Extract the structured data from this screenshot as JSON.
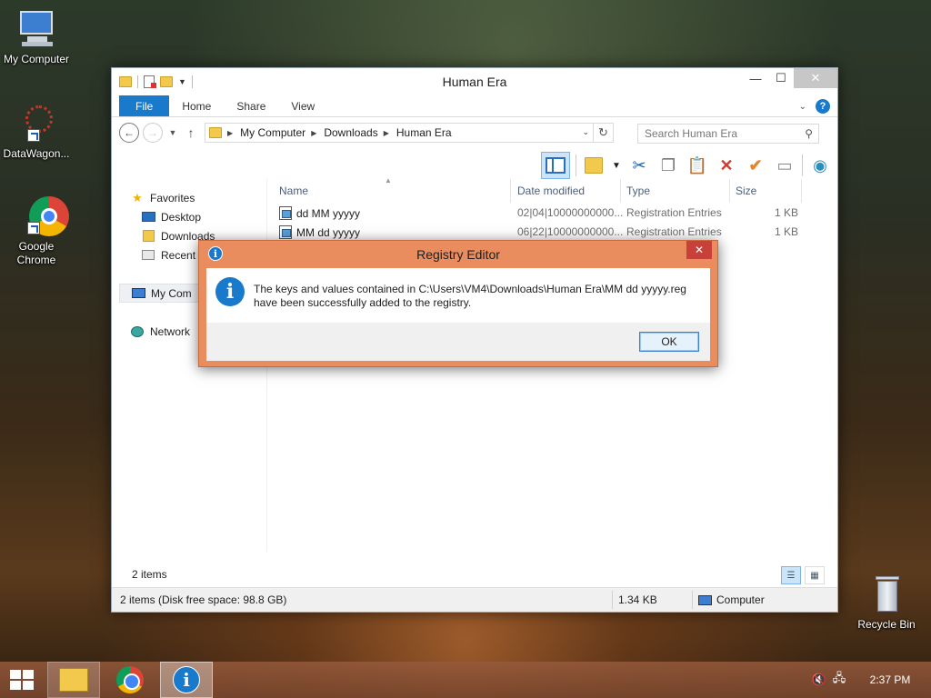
{
  "desktop": {
    "icons": [
      {
        "label": "My Computer"
      },
      {
        "label": "DataWagon..."
      },
      {
        "label": "Google Chrome"
      },
      {
        "label": "Recycle Bin"
      }
    ]
  },
  "explorer": {
    "title": "Human Era",
    "tabs": [
      "File",
      "Home",
      "Share",
      "View"
    ],
    "breadcrumb": [
      "My Computer",
      "Downloads",
      "Human Era"
    ],
    "search_placeholder": "Search Human Era",
    "nav": {
      "favorites": "Favorites",
      "desktop": "Desktop",
      "downloads": "Downloads",
      "recent": "Recent",
      "my_computer": "My Com",
      "network": "Network"
    },
    "columns": [
      "Name",
      "Date modified",
      "Type",
      "Size"
    ],
    "files": [
      {
        "name": "dd MM yyyyy",
        "date": "02|04|10000000000...",
        "type": "Registration Entries",
        "size": "1 KB"
      },
      {
        "name": "MM dd yyyyy",
        "date": "06|22|10000000000...",
        "type": "Registration Entries",
        "size": "1 KB"
      }
    ],
    "item_count": "2 items",
    "status": {
      "left": "2 items (Disk free space: 98.8 GB)",
      "size": "1.34 KB",
      "location": "Computer"
    }
  },
  "dialog": {
    "title": "Registry Editor",
    "message_line1": "The keys and values contained in C:\\Users\\VM4\\Downloads\\Human Era\\MM dd yyyyy.reg",
    "message_line2": "have been successfully added to the registry.",
    "ok_label": "OK"
  },
  "taskbar": {
    "clock": "2:37 PM"
  },
  "colors": {
    "accent": "#1979ca",
    "dialog_border": "#e98d5f"
  }
}
